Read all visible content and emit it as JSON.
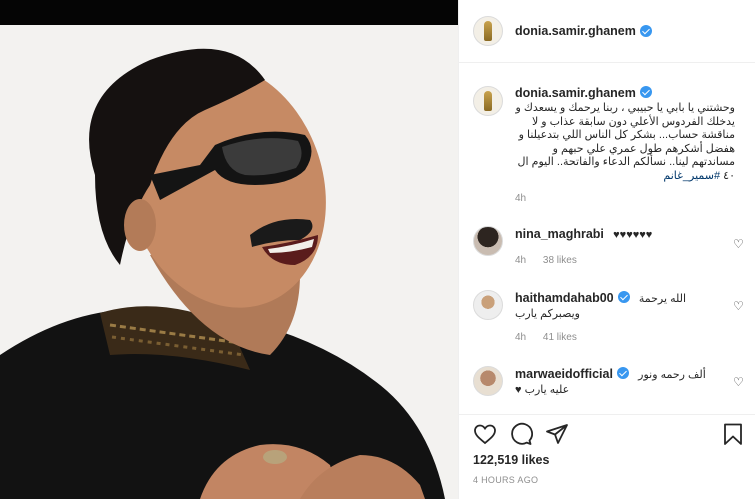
{
  "post": {
    "author": "donia.samir.ghanem",
    "caption": "وحشتني يا بابي يا حبيبي ، ربنا يرحمك و يسعدك و يدخلك الفردوس الأعلي دون سابقة عذاب و لا مناقشة حساب... بشكر كل الناس اللي بتدعيلنا و هفضل أشكرهم طول عمري علي حبهم و مساندتهم لينا.. نسألكم الدعاء والفاتحة.. اليوم ال ٤٠",
    "hashtag": "#سمير_غانم",
    "caption_time": "4h"
  },
  "comments": [
    {
      "user": "nina_maghrabi",
      "verified": false,
      "text": "♥♥♥♥♥♥",
      "time": "4h",
      "likes": "38 likes"
    },
    {
      "user": "haithamdahab00",
      "verified": true,
      "text": "الله يرحمة",
      "text2": "ويصبركم يارب",
      "time": "4h",
      "likes": "41 likes"
    },
    {
      "user": "marwaeidofficial",
      "verified": true,
      "text": "ألف رحمه ونور",
      "text2": "عليه يارب ♥"
    }
  ],
  "footer": {
    "likes": "122,519 likes",
    "posted": "4 HOURS AGO"
  },
  "icons": {
    "like": "heart-outline",
    "comment": "speech-bubble",
    "share": "paper-plane",
    "save": "bookmark"
  },
  "colors": {
    "verified": "#3897f0",
    "meta": "#8e8e8e",
    "hashtag": "#00376b"
  }
}
